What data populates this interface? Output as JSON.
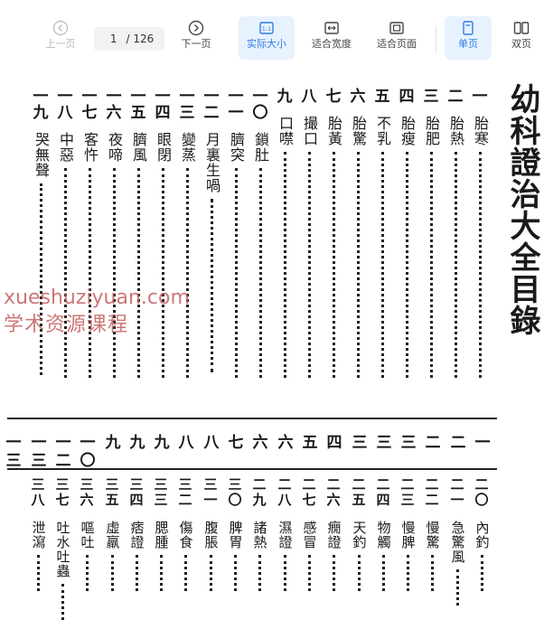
{
  "toolbar": {
    "prev_label": "上一页",
    "page_current": "1",
    "page_total": "/ 126",
    "next_label": "下一页",
    "actual_size_label": "实际大小",
    "fit_width_label": "适合宽度",
    "fit_page_label": "适合页面",
    "single_page_label": "单页",
    "double_page_label": "双页"
  },
  "document": {
    "title": "幼科證治大全目錄",
    "top_entries": [
      {
        "num": "一",
        "name": "胎寒"
      },
      {
        "num": "二",
        "name": "胎熱"
      },
      {
        "num": "三",
        "name": "胎肥"
      },
      {
        "num": "四",
        "name": "胎瘦"
      },
      {
        "num": "五",
        "name": "不乳"
      },
      {
        "num": "六",
        "name": "胎驚"
      },
      {
        "num": "七",
        "name": "胎黃"
      },
      {
        "num": "八",
        "name": "撮口"
      },
      {
        "num": "九",
        "name": "口噤"
      },
      {
        "num": "一〇",
        "name": "鎖肚"
      },
      {
        "num": "一一",
        "name": "臍突"
      },
      {
        "num": "一二",
        "name": "月裏生喎"
      },
      {
        "num": "一三",
        "name": "變蒸"
      },
      {
        "num": "一四",
        "name": "眼閉"
      },
      {
        "num": "一五",
        "name": "臍風"
      },
      {
        "num": "一六",
        "name": "夜啼"
      },
      {
        "num": "一七",
        "name": "客忤"
      },
      {
        "num": "一八",
        "name": "中惡"
      },
      {
        "num": "一九",
        "name": "哭無聲"
      }
    ],
    "page_numbers": [
      "一",
      "二",
      "二",
      "三",
      "三",
      "三",
      "四",
      "五",
      "六",
      "六",
      "七",
      "八",
      "八",
      "九",
      "九",
      "九",
      "一〇",
      "一二",
      "一三",
      "一三"
    ],
    "bottom_entries": [
      {
        "num": "二〇",
        "name": "內釣"
      },
      {
        "num": "二一",
        "name": "急驚風"
      },
      {
        "num": "二二",
        "name": "慢驚"
      },
      {
        "num": "二三",
        "name": "慢脾"
      },
      {
        "num": "二四",
        "name": "物觸"
      },
      {
        "num": "二五",
        "name": "天釣"
      },
      {
        "num": "二六",
        "name": "癇證"
      },
      {
        "num": "二七",
        "name": "感冒"
      },
      {
        "num": "二八",
        "name": "濕證"
      },
      {
        "num": "二九",
        "name": "諸熱"
      },
      {
        "num": "三〇",
        "name": "脾胃"
      },
      {
        "num": "三一",
        "name": "腹脹"
      },
      {
        "num": "三二",
        "name": "傷食"
      },
      {
        "num": "三三",
        "name": "腮腫"
      },
      {
        "num": "三四",
        "name": "痞證"
      },
      {
        "num": "三五",
        "name": "虛羸"
      },
      {
        "num": "三六",
        "name": "嘔吐"
      },
      {
        "num": "三七",
        "name": "吐水吐蟲"
      },
      {
        "num": "三八",
        "name": "泄瀉"
      }
    ]
  },
  "watermark": {
    "line1": "xueshuziyuan.com",
    "line2": "学术资源课程"
  }
}
